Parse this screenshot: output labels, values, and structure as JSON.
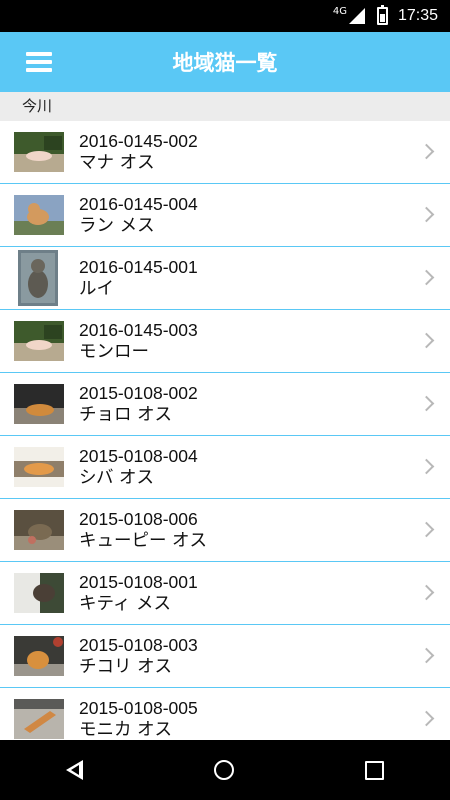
{
  "status_bar": {
    "network": "4G",
    "time": "17:35"
  },
  "app_bar": {
    "title": "地域猫一覧",
    "menu_icon": "hamburger-menu-icon"
  },
  "section": {
    "header": "今川"
  },
  "cats": [
    {
      "id": "2016-0145-002",
      "name": "マナ オス"
    },
    {
      "id": "2016-0145-004",
      "name": "ラン メス"
    },
    {
      "id": "2016-0145-001",
      "name": "ルイ"
    },
    {
      "id": "2016-0145-003",
      "name": "モンロー"
    },
    {
      "id": "2015-0108-002",
      "name": "チョロ オス"
    },
    {
      "id": "2015-0108-004",
      "name": "シバ オス"
    },
    {
      "id": "2015-0108-006",
      "name": "キューピー オス"
    },
    {
      "id": "2015-0108-001",
      "name": "キティ メス"
    },
    {
      "id": "2015-0108-003",
      "name": "チコリ オス"
    },
    {
      "id": "2015-0108-005",
      "name": "モニカ オス"
    }
  ],
  "colors": {
    "accent": "#5ac8f5",
    "divider": "#5ac8f5",
    "section_bg": "#ececec"
  }
}
